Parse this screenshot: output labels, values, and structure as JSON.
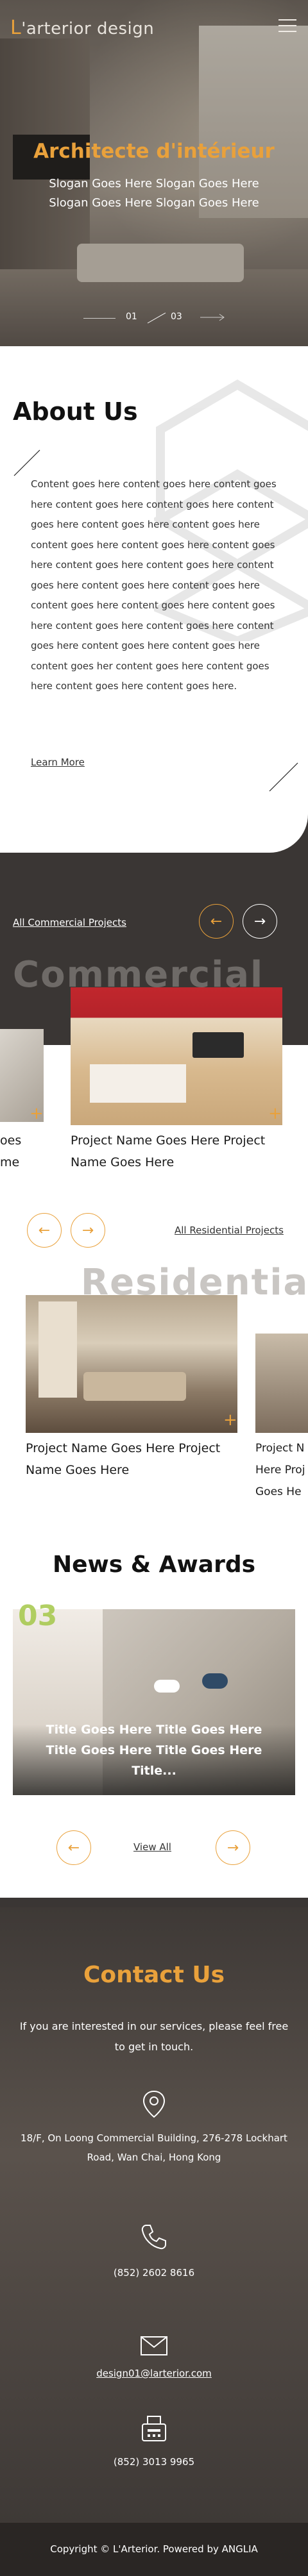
{
  "header": {
    "logo_initial": "L",
    "logo_rest": "'arterior design"
  },
  "hero": {
    "title": "Architecte d'intérieur",
    "slogan": "Slogan Goes Here Slogan Goes Here Slogan Goes Here Slogan Goes Here",
    "current_slide": "01",
    "total_slides": "03"
  },
  "about": {
    "title": "About Us",
    "body": "Content goes here content goes here content goes here content goes here content goes here content goes here content goes here content goes here content goes here content goes here content goes here content goes here content goes here content goes here content goes here content goes here content goes here content goes here content goes here content goes here content goes here content goes here content goes here content goes here content goes her content goes here content goes here content goes here content goes here.",
    "learn_more": "Learn More"
  },
  "commercial": {
    "link": "All Commercial Projects",
    "ghost_title": "Commercial",
    "peek_lines": [
      "oes",
      "me"
    ],
    "project_name": "Project Name Goes Here Project Name Goes Here",
    "prev_arrow": "←",
    "next_arrow": "→"
  },
  "residential": {
    "link": "All Residential Projects",
    "ghost_title": "Residential",
    "project_name": "Project Name Goes Here Project Name Goes Here",
    "peek_name": "Project N Here Proj Goes He",
    "prev_arrow": "←",
    "next_arrow": "→"
  },
  "news": {
    "title": "News & Awards",
    "number": "03",
    "card_title": "Title Goes Here Title Goes Here Title Goes Here Title Goes Here Title...",
    "view_all": "View All",
    "prev_arrow": "←",
    "next_arrow": "→"
  },
  "contact": {
    "title": "Contact Us",
    "intro": "If you are interested in our services, please feel free to get in touch.",
    "address": "18/F, On Loong Commercial Building, 276-278 Lockhart Road, Wan Chai, Hong Kong",
    "phone": "(852) 2602 8616",
    "email": "design01@larterior.com",
    "fax": "(852) 3013 9965"
  },
  "footer": {
    "text": "Copyright © L'Arterior. Powered by ANGLIA"
  },
  "colors": {
    "accent": "#e9a13b",
    "dark": "#3a3634",
    "white": "#ffffff"
  }
}
